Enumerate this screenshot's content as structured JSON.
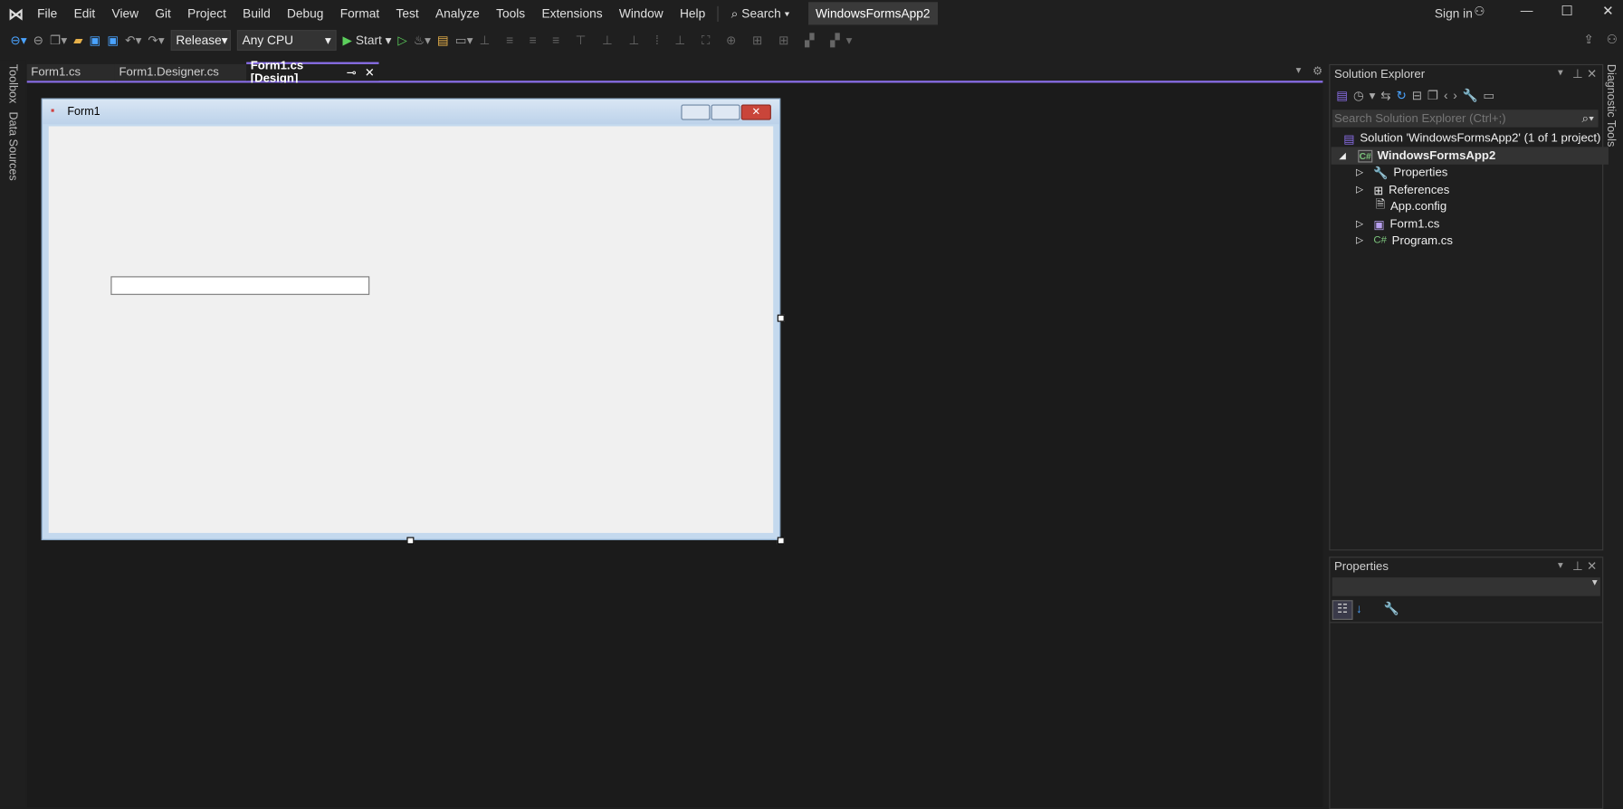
{
  "menu": [
    "File",
    "Edit",
    "View",
    "Git",
    "Project",
    "Build",
    "Debug",
    "Format",
    "Test",
    "Analyze",
    "Tools",
    "Extensions",
    "Window",
    "Help"
  ],
  "search_label": "Search",
  "solution_title": "WindowsFormsApp2",
  "sign_in": "Sign in",
  "toolbar": {
    "configuration": "Release",
    "platform": "Any CPU",
    "start": "Start"
  },
  "tabs": [
    {
      "label": "Form1.cs"
    },
    {
      "label": "Form1.Designer.cs"
    },
    {
      "label": "Form1.cs [Design]",
      "active": true
    }
  ],
  "left_strip": [
    "Toolbox",
    "Data Sources"
  ],
  "right_strip": "Diagnostic Tools",
  "form": {
    "title": "Form1",
    "textbox_value": ""
  },
  "solution_explorer": {
    "title": "Solution Explorer",
    "search_placeholder": "Search Solution Explorer (Ctrl+;)",
    "items": [
      {
        "label": "Solution 'WindowsFormsApp2' (1 of 1 project)",
        "icon": "solution-icon"
      },
      {
        "label": "WindowsFormsApp2",
        "icon": "csharp-project-icon"
      },
      {
        "label": "Properties",
        "icon": "wrench-icon"
      },
      {
        "label": "References",
        "icon": "references-icon"
      },
      {
        "label": "App.config",
        "icon": "config-icon"
      },
      {
        "label": "Form1.cs",
        "icon": "form-icon"
      },
      {
        "label": "Program.cs",
        "icon": "csharp-file-icon"
      }
    ]
  },
  "properties": {
    "title": "Properties"
  },
  "colors": {
    "accent": "#8a6ee8",
    "background": "#1f1f1f",
    "form_client": "#f0f0f0"
  }
}
